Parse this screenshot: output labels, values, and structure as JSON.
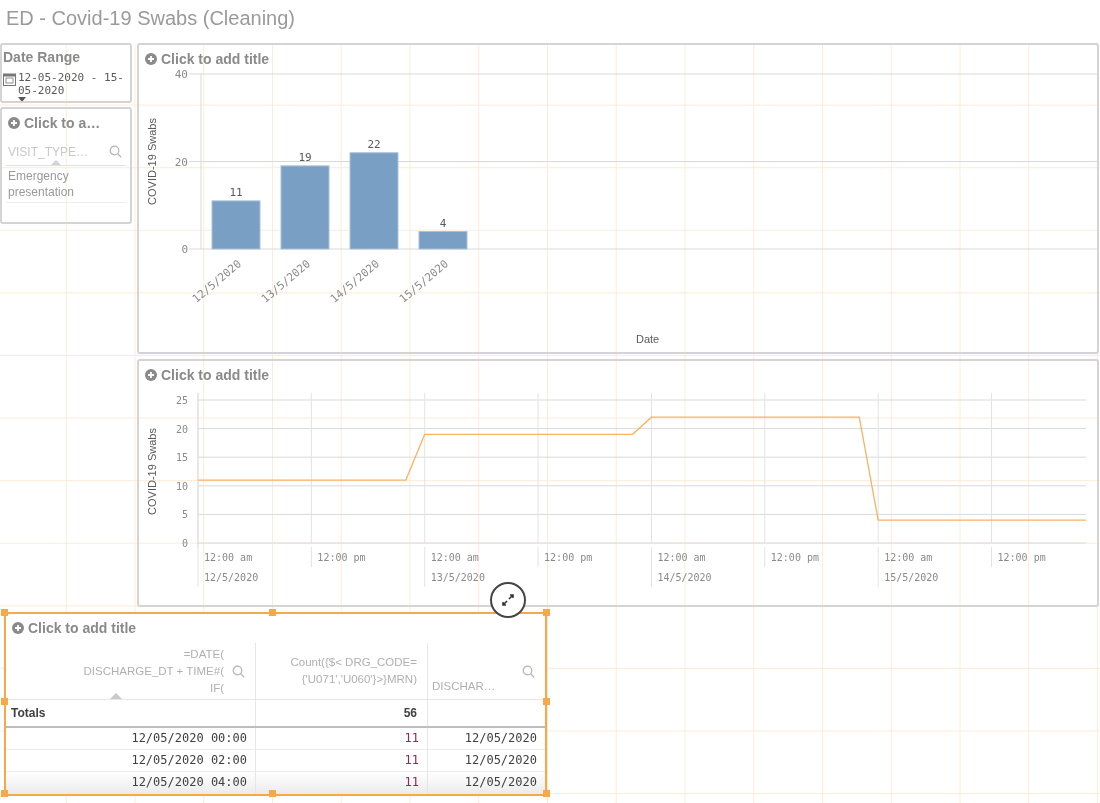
{
  "sheet_title": "ED - Covid-19 Swabs (Cleaning)",
  "date_range": {
    "title": "Date Range",
    "value": "12-05-2020 - 15-05-2020"
  },
  "filter_pane": {
    "title": "Click to a…",
    "search": {
      "placeholder": "VISIT_TYPE…"
    },
    "items": [
      {
        "label": "Emergency presentation",
        "selected": false
      }
    ]
  },
  "bar_chart": {
    "title": "Click to add title",
    "xlabel": "Date",
    "chart_data": {
      "type": "bar",
      "ylabel": "COVID-19 Swabs",
      "categories": [
        "12/5/2020",
        "13/5/2020",
        "14/5/2020",
        "15/5/2020"
      ],
      "series": [
        {
          "color": "#7a9fc4",
          "values": [
            11,
            19,
            22,
            4
          ]
        }
      ],
      "ylim": [
        0,
        40
      ],
      "yticks": [
        0,
        20,
        40
      ],
      "data_labels": true
    }
  },
  "line_chart": {
    "title": "Click to add title",
    "chart_data": {
      "type": "line",
      "grid": true,
      "ylabel": "COVID-19 Swabs",
      "categories": [
        null,
        null,
        null,
        null,
        null,
        null,
        null,
        null,
        null,
        null,
        null,
        null,
        null,
        null,
        null,
        null,
        null,
        null,
        null,
        null,
        null,
        null,
        null,
        null,
        null,
        null,
        null,
        null,
        null,
        null,
        null,
        null,
        null,
        null,
        null,
        null,
        null,
        null,
        null,
        null,
        null,
        null,
        null,
        null,
        null,
        null,
        null,
        null
      ],
      "series": [
        {
          "color": "#f7b267",
          "values": [
            11,
            11,
            11,
            11,
            11,
            11,
            11,
            11,
            11,
            11,
            11,
            11,
            19,
            19,
            19,
            19,
            19,
            19,
            19,
            19,
            19,
            19,
            19,
            19,
            22,
            22,
            22,
            22,
            22,
            22,
            22,
            22,
            22,
            22,
            22,
            22,
            4,
            4,
            4,
            4,
            4,
            4,
            4,
            4,
            4,
            4,
            4,
            4
          ]
        }
      ],
      "ylim": [
        0,
        25
      ],
      "yticks": [
        0,
        5,
        10,
        15,
        20,
        25
      ]
    },
    "time_labels": [
      "12:00 am",
      "12:00 pm",
      "12:00 am",
      "12:00 pm",
      "12:00 am",
      "12:00 pm",
      "12:00 am",
      "12:00 pm"
    ],
    "date_labels": [
      "12/5/2020",
      "13/5/2020",
      "14/5/2020",
      "15/5/2020"
    ]
  },
  "table": {
    "title": "Click to add title",
    "selected": true,
    "columns": [
      {
        "header": "=DATE(\nDISCHARGE_DT + TIME#(\nIF(",
        "searchable": true,
        "sorted": true
      },
      {
        "header": "Count({$< DRG_CODE=\n{'U071','U060'}>}MRN)",
        "searchable": false,
        "sorted": false
      },
      {
        "header": "DISCHAR…",
        "searchable": true,
        "sorted": false
      }
    ],
    "totals": [
      "Totals",
      "56"
    ],
    "rows": [
      [
        "12/05/2020 00:00",
        "11",
        "12/05/2020"
      ],
      [
        "12/05/2020 02:00",
        "11",
        "12/05/2020"
      ],
      [
        "12/05/2020 04:00",
        "11",
        "12/05/2020"
      ]
    ]
  }
}
